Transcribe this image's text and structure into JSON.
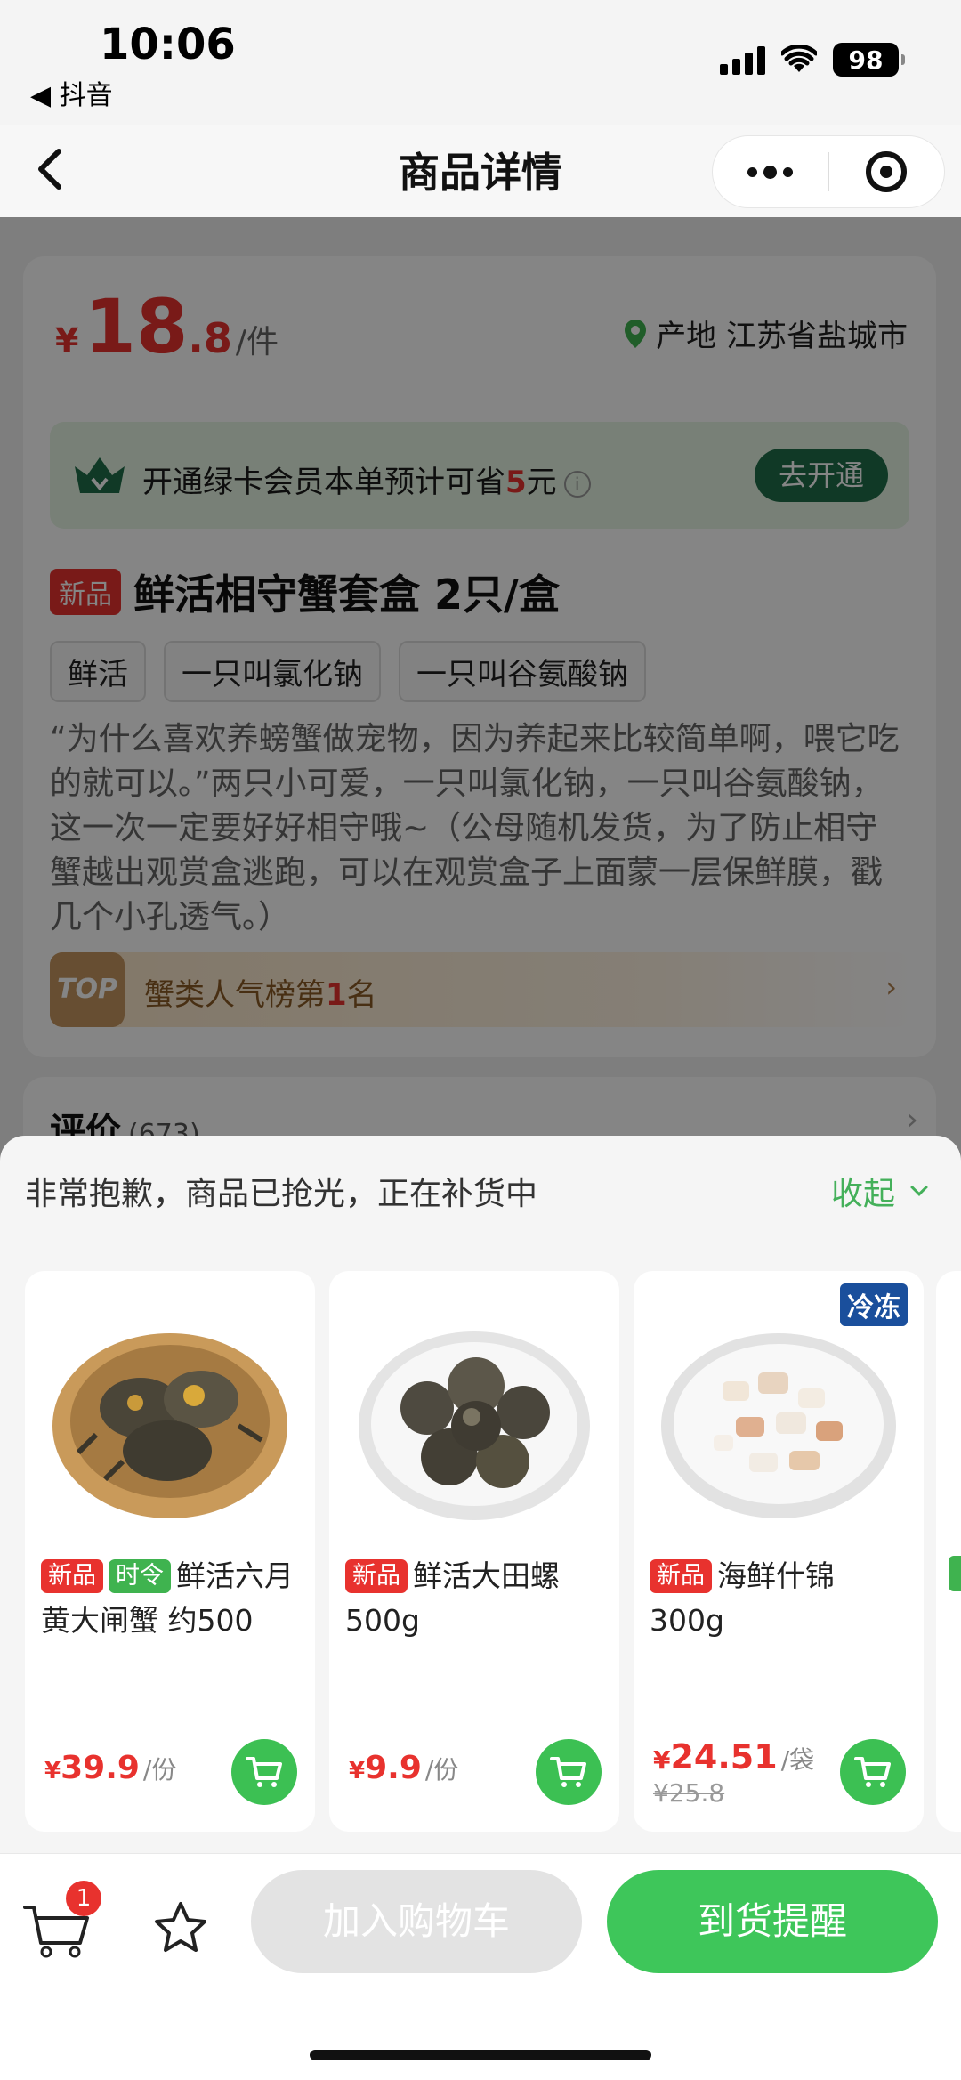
{
  "status_bar": {
    "time": "10:06",
    "back_app": "◀ 抖音",
    "battery": "98"
  },
  "nav": {
    "title": "商品详情"
  },
  "product": {
    "price_symbol": "¥",
    "price_int": "18",
    "price_dec": ".8",
    "price_unit": "/件",
    "origin": "产地 江苏省盐城市",
    "member_text_pre": "开通绿卡会员本单预计可省",
    "member_saving": "5",
    "member_text_post": "元",
    "member_button": "去开通",
    "new_tag": "新品",
    "title": "鲜活相守蟹套盒 2只/盒",
    "chips": [
      "鲜活",
      "一只叫氯化钠",
      "一只叫谷氨酸钠"
    ],
    "description": "“为什么喜欢养螃蟹做宠物，因为养起来比较简单啊，喂它吃的就可以。”两只小可爱，一只叫氯化钠，一只叫谷氨酸钠，这一次一定要好好相守哦~（公母随机发货，为了防止相守蟹越出观赏盒逃跑，可以在观赏盒子上面蒙一层保鲜膜，戳几个小孔透气。）",
    "rank_badge": "TOP",
    "rank_pre": "蟹类人气榜第",
    "rank_num": "1",
    "rank_post": "名",
    "rank_arrow": "›",
    "reviews_title": "评价",
    "reviews_count": "(673)",
    "reviews_arrow": "›"
  },
  "sheet": {
    "message": "非常抱歉，商品已抢光，正在补货中",
    "collapse": "收起",
    "products": [
      {
        "tags": [
          "新品",
          "时令"
        ],
        "name": "鲜活六月黄大闸蟹 约500",
        "price_symbol": "¥",
        "price": "39.9",
        "unit": "/份"
      },
      {
        "tags": [
          "新品"
        ],
        "name": "鲜活大田螺 500g",
        "price_symbol": "¥",
        "price": "9.9",
        "unit": "/份"
      },
      {
        "badge": "冷冻",
        "tags": [
          "新品"
        ],
        "name": "海鲜什锦 300g",
        "price_symbol": "¥",
        "price": "24.51",
        "unit": "/袋",
        "original_price": "¥25.8"
      }
    ]
  },
  "bottom_bar": {
    "cart_badge": "1",
    "add_to_cart": "加入购物车",
    "notify": "到货提醒"
  },
  "colors": {
    "accent_green": "#3ec65a",
    "price_red": "#e8322e",
    "member_dark": "#1f6e49"
  }
}
